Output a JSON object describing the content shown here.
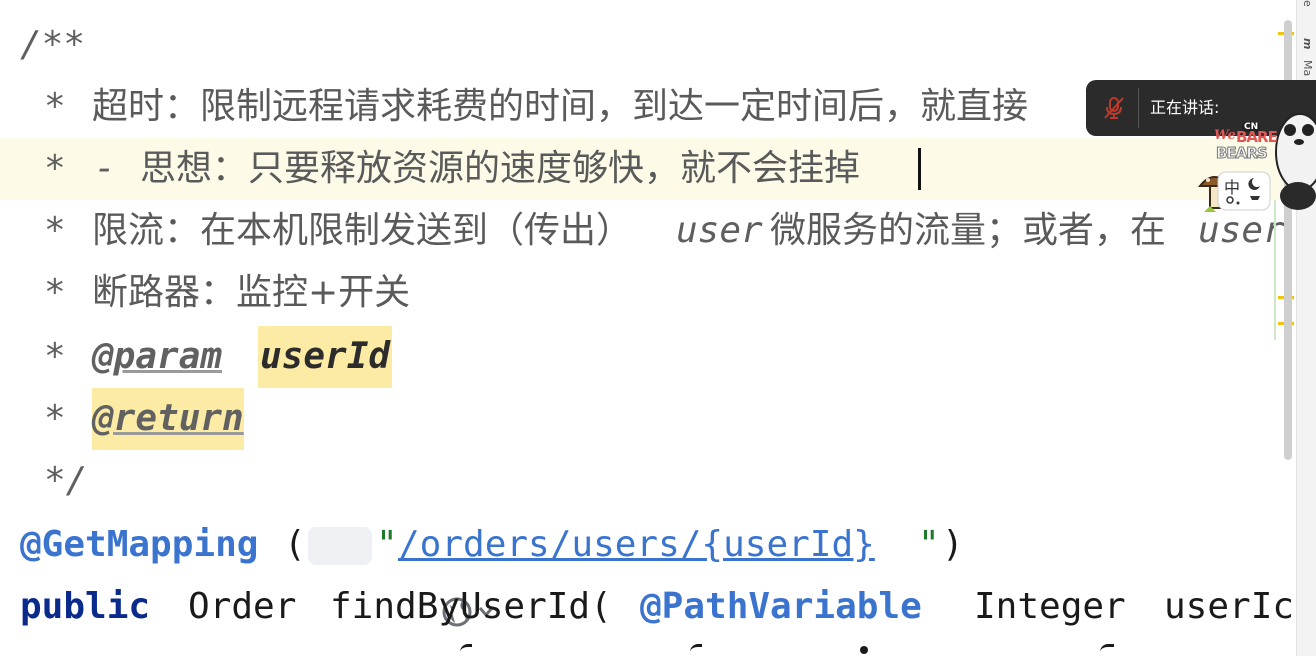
{
  "editor": {
    "comment_open": "/**",
    "line_timeout": {
      "star": "*",
      "text": "超时：限制远程请求耗费的时间，到达一定时间后，就直接"
    },
    "line_idea": {
      "star": "*",
      "dash": "-",
      "text": "思想：只要释放资源的速度够快，就不会挂掉"
    },
    "line_ratelimit": {
      "star": "*",
      "text_a": "限流：在本机限制发送到（传出）",
      "code_a": "user",
      "text_b": "微服务的流量；或者，在",
      "code_b": "user"
    },
    "line_breaker": {
      "star": "*",
      "text": "断路器：监控+开关"
    },
    "line_param": {
      "star": "*",
      "tag": "@param",
      "name": "userId"
    },
    "line_return": {
      "star": "*",
      "tag": "@return"
    },
    "comment_close": "*/",
    "annotation": {
      "name": "@GetMapping",
      "open": "(",
      "quote_open": "\"",
      "path": "/orders/users/{userId}",
      "quote_close": "\"",
      "close": ")"
    },
    "method": {
      "keyword": "public",
      "type": "Order",
      "name": "findByUserId(",
      "param_anno": "@PathVariable",
      "param_type": "Integer",
      "param_name": "userIc"
    }
  },
  "right_strip": {
    "top_char": "e",
    "label_a": "m",
    "label_b": "Ma"
  },
  "overlay": {
    "speaking_label": "正在讲话:",
    "mic_icon": "mic-muted-icon"
  },
  "sticker": {
    "brand_top": "CN",
    "brand_we": "We",
    "brand_bare": "BARE",
    "brand_bears": "BEARS",
    "ime_char": "中"
  },
  "colors": {
    "annotation": "#3b74cf",
    "keyword": "#0b2b8c",
    "comment": "#5f5f5f",
    "highlight": "#fbeba4",
    "current_line": "#fdfbe8"
  }
}
